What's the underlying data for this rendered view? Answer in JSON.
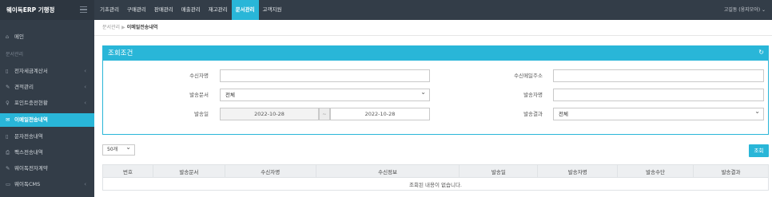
{
  "app": {
    "brand": "웨이독ERP 기행정"
  },
  "top_nav": {
    "items": [
      "기초관리",
      "구매관리",
      "판매관리",
      "매출관리",
      "재고관리",
      "문서관리",
      "고객지원"
    ],
    "active_index": 5,
    "user": "고길동 (웅지모아) ⌄"
  },
  "sidebar": {
    "home": "메인",
    "section": "문서관리",
    "items": [
      {
        "label": "전자세금계산서",
        "icon": "document-icon",
        "chevron": true
      },
      {
        "label": "견적관리",
        "icon": "edit-icon",
        "chevron": true
      },
      {
        "label": "포인트충전현황",
        "icon": "bulb-icon",
        "chevron": true
      },
      {
        "label": "이메일전송내역",
        "icon": "mail-icon",
        "chevron": false,
        "active": true
      },
      {
        "label": "문자전송내역",
        "icon": "mobile-icon",
        "chevron": false
      },
      {
        "label": "팩스전송내역",
        "icon": "fax-icon",
        "chevron": false
      },
      {
        "label": "웨이독전자계약",
        "icon": "edit-icon",
        "chevron": false
      },
      {
        "label": "웨이독CMS",
        "icon": "card-icon",
        "chevron": true
      }
    ]
  },
  "breadcrumb": {
    "parent": "문서관리",
    "separator": "▶",
    "current": "이메일전송내역"
  },
  "search_panel": {
    "title": "조회조건",
    "fields": {
      "recipient_name": {
        "label": "수신자명",
        "value": ""
      },
      "recipient_email": {
        "label": "수신메일주소",
        "value": ""
      },
      "document_type": {
        "label": "발송문서",
        "value": "전체"
      },
      "sender_name": {
        "label": "발송자명",
        "value": ""
      },
      "send_date": {
        "label": "발송일",
        "from": "2022-10-28",
        "tilde": "~",
        "to": "2022-10-28"
      },
      "send_result": {
        "label": "발송결과",
        "value": "전체"
      }
    }
  },
  "list": {
    "per_page": "50개",
    "search_button": "조회",
    "columns": [
      "번호",
      "발송문서",
      "수신자명",
      "수신정보",
      "발송일",
      "발송자명",
      "발송수단",
      "발송결과"
    ],
    "empty_message": "조회된 내용이 없습니다."
  }
}
